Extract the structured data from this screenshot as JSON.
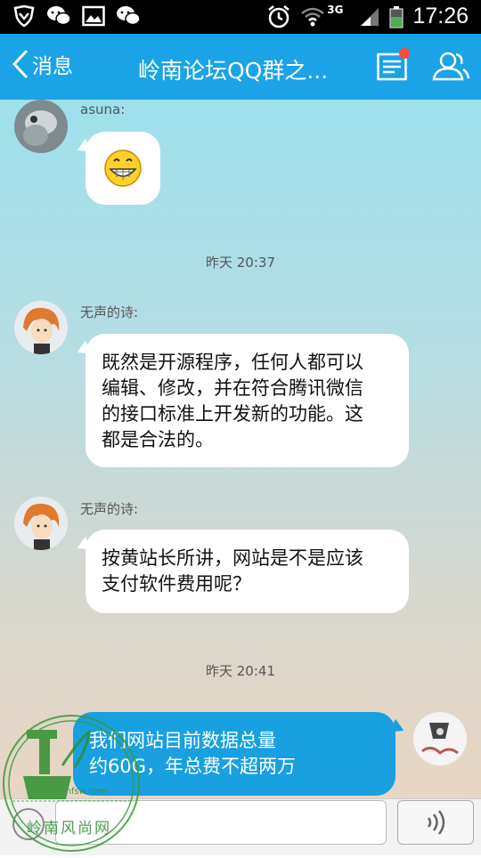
{
  "status_bar": {
    "time": "17:26",
    "network": "3G"
  },
  "header": {
    "back_label": "消息",
    "title": "岭南论坛QQ群之..."
  },
  "messages": [
    {
      "sender": "asuna:"
    },
    {
      "time": "昨天 20:37"
    },
    {
      "sender": "无声的诗:",
      "text": [
        "既然是开源程序，任何人都可以",
        "编辑、修改，并在符合腾讯微信",
        "的接口标准上开发新的功能。这",
        "都是合法的。"
      ]
    },
    {
      "sender": "无声的诗:",
      "text": [
        "按黄站长所讲，网站是不是应该",
        "支付软件费用呢？"
      ]
    },
    {
      "time": "昨天 20:41"
    },
    {
      "text": [
        "我们网站目前数据总量",
        "约60G，年总费不超两万"
      ]
    }
  ],
  "watermark": {
    "site": "www.lnfsw.com",
    "name": "岭南风尚网"
  },
  "input": {
    "placeholder": ""
  },
  "colors": {
    "accent": "#1aa3e6",
    "outgoing_bubble": "#18a0e0",
    "badge": "#ff4b3a"
  }
}
